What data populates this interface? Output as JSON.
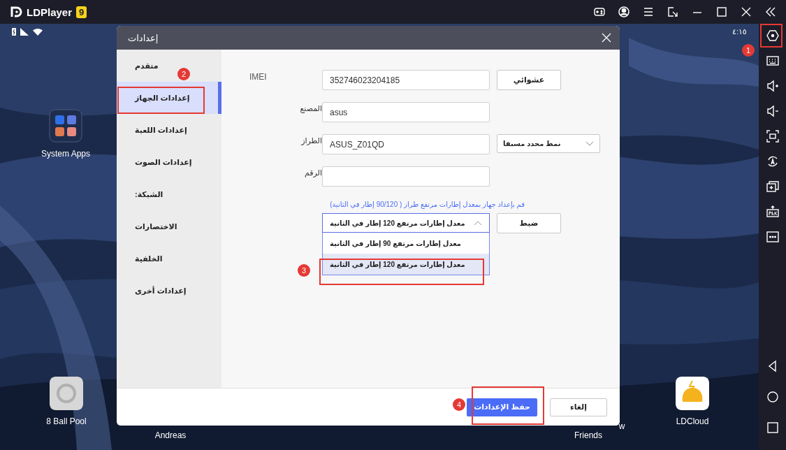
{
  "app": {
    "title": "LDPlayer",
    "version_badge": "9"
  },
  "status_bar": {
    "time": "٤:١٥"
  },
  "desktop_icons": [
    {
      "kind": "folder",
      "label": "System Apps"
    },
    {
      "kind": "app",
      "label": "8 Ball Pool"
    },
    {
      "kind": "cloud",
      "label": "LDCloud"
    }
  ],
  "desktop_labels": [
    "Andreas",
    "w",
    "Friends"
  ],
  "dialog": {
    "title": "إعدادات",
    "nav": [
      {
        "label": "متقدم",
        "selected": false
      },
      {
        "label": "إعدادات الجهاز",
        "selected": true
      },
      {
        "label": "إعدادات اللعبة",
        "selected": false
      },
      {
        "label": "إعدادات الصوت",
        "selected": false
      },
      {
        "label": "الشبكة:",
        "selected": false
      },
      {
        "label": "الاختصارات",
        "selected": false
      },
      {
        "label": "الخلفية",
        "selected": false
      },
      {
        "label": "إعدادات أخرى",
        "selected": false
      }
    ],
    "fields": [
      {
        "kind": "button",
        "label": "IMEI",
        "value": "352746023204185",
        "action": "عشوائي"
      },
      {
        "kind": "plain",
        "label": "المصنع",
        "value": "asus"
      },
      {
        "kind": "select",
        "label": "الطراز",
        "value": "ASUS_Z01QD",
        "action": "نمط محدد مسبقا"
      },
      {
        "kind": "plain",
        "label": "الرقم"
      }
    ],
    "fps": {
      "hint": "قم بإعداد جهاز بمعدل إطارات مرتفع طراز ( 90/120 إطار في الثانية)",
      "value": "معدل إطارات مرتفع 120 إطار في الثانية",
      "expanded": true,
      "options": [
        {
          "label": "معدل إطارات مرتفع 90 إطار في الثانية",
          "selected": false
        },
        {
          "label": "معدل إطارات مرتفع 120 إطار في الثانية",
          "selected": true
        }
      ],
      "action": "ضبط"
    },
    "save": "حفظ الإعدادات",
    "cancel": "إلغاء"
  },
  "annotations": [
    "1",
    "2",
    "3",
    "4"
  ]
}
